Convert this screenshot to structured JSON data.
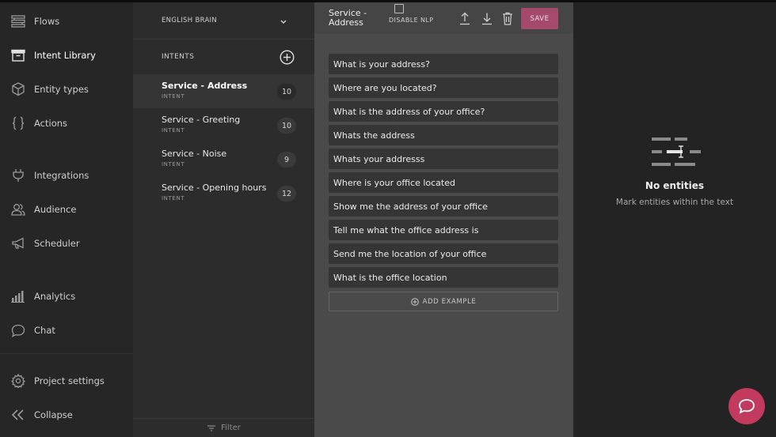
{
  "nav": {
    "items": [
      {
        "label": "Flows",
        "icon": "flows-icon"
      },
      {
        "label": "Intent Library",
        "icon": "intent-library-icon",
        "active": true
      },
      {
        "label": "Entity types",
        "icon": "entity-types-icon"
      },
      {
        "label": "Actions",
        "icon": "actions-icon"
      },
      {
        "label": "Integrations",
        "icon": "plug-icon"
      },
      {
        "label": "Audience",
        "icon": "audience-icon"
      },
      {
        "label": "Scheduler",
        "icon": "megaphone-icon"
      },
      {
        "label": "Analytics",
        "icon": "bar-chart-icon"
      },
      {
        "label": "Chat",
        "icon": "chat-bubble-icon"
      },
      {
        "label": "Project settings",
        "icon": "gear-icon"
      },
      {
        "label": "Collapse",
        "icon": "double-chevron-left-icon"
      }
    ]
  },
  "intents_panel": {
    "brain": "ENGLISH BRAIN",
    "header": "INTENTS",
    "filter_label": "Filter",
    "items": [
      {
        "name": "Service - Address",
        "type": "INTENT",
        "count": "10",
        "selected": true
      },
      {
        "name": "Service - Greeting",
        "type": "INTENT",
        "count": "10"
      },
      {
        "name": "Service - Noise",
        "type": "INTENT",
        "count": "9"
      },
      {
        "name": "Service - Opening hours",
        "type": "INTENT",
        "count": "12"
      }
    ]
  },
  "editor": {
    "title": "Service - Address",
    "disable_nlp_label": "DISABLE NLP",
    "save_label": "SAVE",
    "add_example_label": "ADD EXAMPLE",
    "examples": [
      "What is your address?",
      "Where are you located?",
      "What is the address of your office?",
      "Whats the address",
      "Whats your addresss",
      "Where is your office located",
      "Show me the address of your office",
      "Tell me what the office address is",
      "Send me the location of your office",
      "What is the office location"
    ]
  },
  "entities_panel": {
    "title": "No entities",
    "subtitle": "Mark entities within the text"
  },
  "colors": {
    "accent": "#a64a6d",
    "chat_fab": "#c33a5f"
  }
}
